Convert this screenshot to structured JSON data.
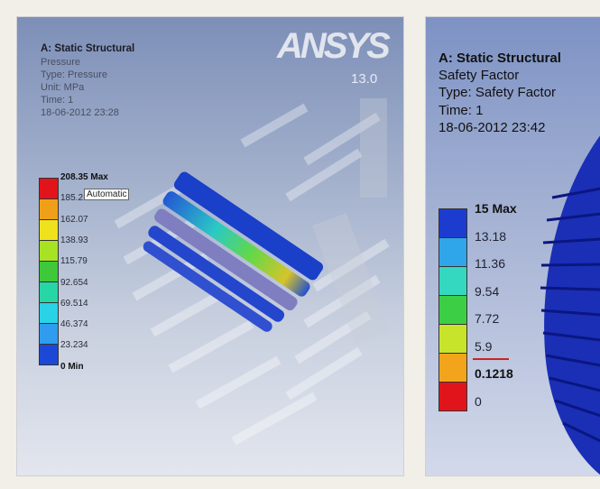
{
  "left_panel": {
    "title": "A: Static Structural",
    "lines": [
      "Pressure",
      "Type: Pressure",
      "Unit: MPa",
      "Time: 1",
      "18-06-2012 23:28"
    ],
    "logo": "ANSYS",
    "version": "13.0",
    "auto_label": "Automatic",
    "legend": {
      "labels": [
        "208.35 Max",
        "185.21",
        "162.07",
        "138.93",
        "115.79",
        "92.654",
        "69.514",
        "46.374",
        "23.234",
        "0 Min"
      ],
      "colors": [
        "#e2141b",
        "#f0a018",
        "#efe21c",
        "#a8e224",
        "#3fc83a",
        "#27d6a6",
        "#29d2e6",
        "#2f9cee",
        "#1c48d8"
      ]
    }
  },
  "right_panel": {
    "title": "A: Static Structural",
    "lines": [
      "Safety Factor",
      "Type: Safety Factor",
      "Time: 1",
      "18-06-2012 23:42"
    ],
    "legend": {
      "labels": [
        "15 Max",
        "13.18",
        "11.36",
        "9.54",
        "7.72",
        "5.9",
        "0.1218",
        "0"
      ],
      "colors": [
        "#1c3ccf",
        "#2fa6ea",
        "#34d8c0",
        "#3ccf46",
        "#c8e42a",
        "#f2a51c",
        "#e2141b"
      ]
    }
  }
}
